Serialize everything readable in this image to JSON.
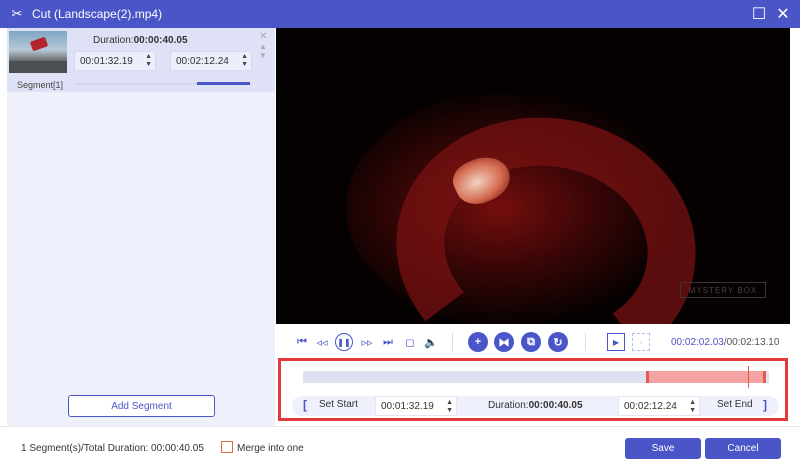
{
  "window": {
    "title": "Cut (Landscape(2).mp4)",
    "maximize_glyph": "☐",
    "close_glyph": "✕",
    "logo_glyph": "✂"
  },
  "segment_list": {
    "items": [
      {
        "label": "Segment[1]",
        "duration_label": "Duration:",
        "duration_value": "00:00:40.05",
        "start": "00:01:32.19",
        "end": "00:02:12.24",
        "progress": 0.3
      }
    ],
    "add_segment_label": "Add Segment"
  },
  "video": {
    "watermark": "MYSTERY BOX"
  },
  "controls": {
    "current_time": "00:02:02.03",
    "total_time": "/00:02:13.10"
  },
  "timeline": {
    "set_start_label": "Set Start",
    "set_end_label": "Set End",
    "start": "00:01:32.19",
    "end": "00:02:12.24",
    "duration_label": "Duration:",
    "duration_value": "00:00:40.05",
    "open_bracket": "[",
    "close_bracket": "]"
  },
  "footer": {
    "total_text": "1 Segment(s)/Total Duration: 00:00:40.05",
    "merge_label": "Merge into one",
    "save_label": "Save",
    "cancel_label": "Cancel"
  },
  "colors": {
    "accent": "#4a55c8",
    "highlight": "#e23a3a"
  },
  "icons": {
    "app": "scissors-icon",
    "controls": [
      "skip-to-start-icon",
      "step-back-icon",
      "pause-icon",
      "step-forward-icon",
      "skip-to-end-icon",
      "stop-icon",
      "volume-icon",
      "add-icon",
      "split-icon",
      "copy-icon",
      "reset-icon",
      "preview-icon",
      "fullscreen-icon"
    ]
  }
}
